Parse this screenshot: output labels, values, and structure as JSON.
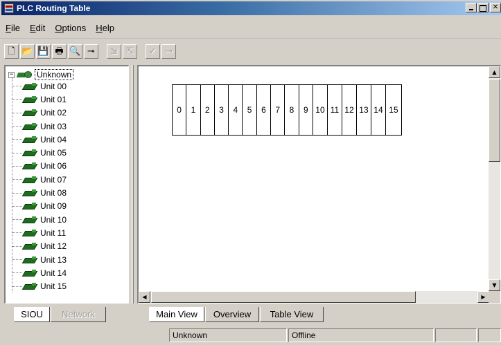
{
  "window": {
    "title": "PLC Routing Table",
    "controls": [
      "minimize",
      "maximize",
      "close"
    ]
  },
  "menu": [
    {
      "label": "File",
      "mnemonic": "F",
      "rest": "ile"
    },
    {
      "label": "Edit",
      "mnemonic": "E",
      "rest": "dit"
    },
    {
      "label": "Options",
      "mnemonic": "O",
      "rest": "ptions"
    },
    {
      "label": "Help",
      "mnemonic": "H",
      "rest": "elp"
    }
  ],
  "toolbar": {
    "buttons": [
      {
        "name": "new-file-icon",
        "glyph": "🗋",
        "enabled": true
      },
      {
        "name": "open-folder-icon",
        "glyph": "📂",
        "enabled": true
      },
      {
        "name": "save-icon",
        "glyph": "💾",
        "enabled": false
      },
      {
        "name": "print-icon",
        "glyph": "🖶",
        "enabled": true
      },
      {
        "name": "print-preview-icon",
        "glyph": "🔍",
        "enabled": true
      },
      {
        "name": "pin-icon",
        "glyph": "⊸",
        "enabled": true
      },
      {
        "name": "transfer-to-plc-icon",
        "glyph": "⇲",
        "enabled": false
      },
      {
        "name": "transfer-from-plc-icon",
        "glyph": "⇱",
        "enabled": false
      },
      {
        "name": "check-icon",
        "glyph": "✓",
        "enabled": false
      },
      {
        "name": "delete-icon",
        "glyph": "⊸",
        "enabled": false
      }
    ]
  },
  "tree": {
    "root_label": "Unknown",
    "expander": "−",
    "units": [
      "Unit 00",
      "Unit 01",
      "Unit 02",
      "Unit 03",
      "Unit 04",
      "Unit 05",
      "Unit 06",
      "Unit 07",
      "Unit 08",
      "Unit 09",
      "Unit 10",
      "Unit 11",
      "Unit 12",
      "Unit 13",
      "Unit 14",
      "Unit 15"
    ]
  },
  "main_view": {
    "slots": [
      "0",
      "1",
      "2",
      "3",
      "4",
      "5",
      "6",
      "7",
      "8",
      "9",
      "10",
      "11",
      "12",
      "13",
      "14",
      "15"
    ]
  },
  "left_tabs": {
    "siou": "SIOU",
    "network": "Network"
  },
  "view_tabs": {
    "main_view": "Main View",
    "overview": "Overview",
    "table_view": "Table View"
  },
  "status": {
    "left": "Unknown",
    "right": "Offline"
  },
  "scroll_glyphs": {
    "up": "▲",
    "down": "▼",
    "left": "◀",
    "right": "▶"
  }
}
